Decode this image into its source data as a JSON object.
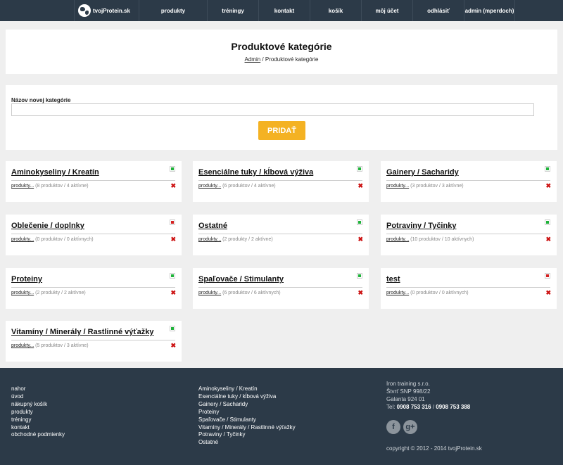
{
  "nav": {
    "logo": "tvojProtein.sk",
    "items": [
      "produkty",
      "tréningy",
      "kontakt",
      "košík",
      "môj účet",
      "odhlásiť",
      "admin (mperdoch)"
    ]
  },
  "header": {
    "title": "Produktové kategórie",
    "breadcrumb_link": "Admin",
    "breadcrumb_sep": " / ",
    "breadcrumb_current": "Produktové kategórie"
  },
  "form": {
    "label": "Názov novej kategórie",
    "input_value": "",
    "button": "PRIDAŤ"
  },
  "colors": {
    "accent": "#f4b223",
    "nav_bg": "#2c3a48",
    "active": "#1fb33a",
    "inactive": "#d42222"
  },
  "categories": [
    {
      "name": "Aminokyseliny / Kreatín",
      "link": "produkty...",
      "info": "(8 produktov / 4 aktívne)",
      "active": true
    },
    {
      "name": "Esenciálne tuky / kĺbová výživa",
      "link": "produkty...",
      "info": "(6 produktov / 4 aktívne)",
      "active": true
    },
    {
      "name": "Gainery / Sacharidy",
      "link": "produkty...",
      "info": "(3 produktov / 3 aktívne)",
      "active": true
    },
    {
      "name": "Oblečenie / doplnky",
      "link": "produkty...",
      "info": "(0 produktov / 0 aktívnych)",
      "active": false
    },
    {
      "name": "Ostatné",
      "link": "produkty...",
      "info": "(2 produkty / 2 aktívne)",
      "active": true
    },
    {
      "name": "Potraviny / Tyčinky",
      "link": "produkty...",
      "info": "(10 produktov / 10 aktívnych)",
      "active": true
    },
    {
      "name": "Proteiny",
      "link": "produkty...",
      "info": "(2 produkty / 2 aktívne)",
      "active": true
    },
    {
      "name": "Spaľovače / Stimulanty",
      "link": "produkty...",
      "info": "(6 produktov / 6 aktívnych)",
      "active": true
    },
    {
      "name": "test",
      "link": "produkty...",
      "info": "(0 produktov / 0 aktívnych)",
      "active": false
    },
    {
      "name": "Vitamíny / Minerály / Rastlinné výťažky",
      "link": "produkty...",
      "info": "(5 produktov / 3 aktívne)",
      "active": true
    }
  ],
  "footer": {
    "nav_links": [
      "nahor",
      "úvod",
      "nákupný košík",
      "produkty",
      "tréningy",
      "kontakt",
      "obchodné podmienky"
    ],
    "category_links": [
      "Aminokyseliny / Kreatín",
      "Esenciálne tuky / kĺbová výživa",
      "Gainery / Sacharidy",
      "Proteiny",
      "Spaľovače / Stimulanty",
      "Vitamíny / Minerály / Rastlinné výťažky",
      "Potraviny / Tyčinky",
      "Ostatné"
    ],
    "company": "Iron training s.r.o.",
    "street": "Štvrť SNP 998/22",
    "city": "Galanta 924 01",
    "tel_label": "Tel: ",
    "tel1": "0908 753 316",
    "tel_sep": " / ",
    "tel2": "0908 753 388",
    "social": [
      {
        "icon": "facebook-icon",
        "glyph": "f"
      },
      {
        "icon": "google-plus-icon",
        "glyph": "g+"
      }
    ],
    "copyright": "copyright © 2012 - 2014 tvojProtein.sk"
  }
}
